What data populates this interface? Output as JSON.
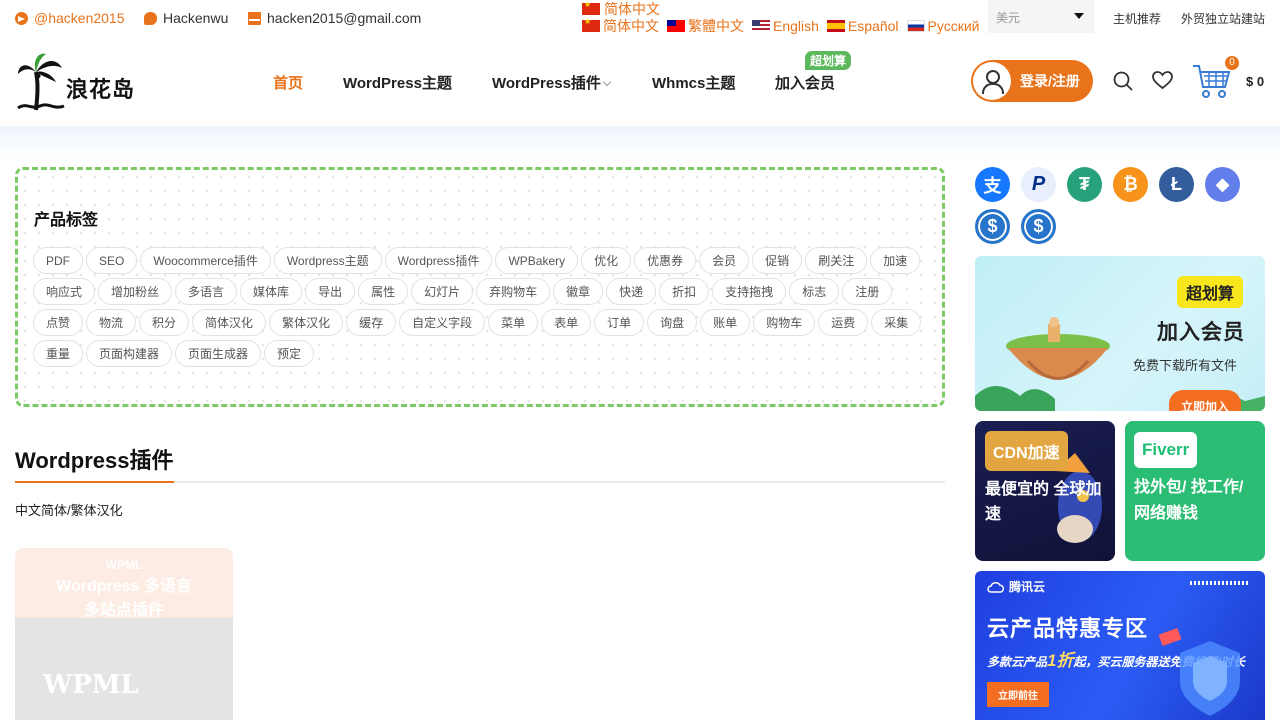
{
  "topbar": {
    "telegram": "@hacken2015",
    "wechat": "Hackenwu",
    "email": "hacken2015@gmail.com",
    "language_current": "简体中文",
    "languages": [
      "简体中文",
      "繁體中文",
      "English",
      "Español",
      "Русский"
    ],
    "currency": "美元",
    "links": [
      "主机推荐",
      "外贸独立站建站"
    ]
  },
  "header": {
    "logo_text": "浪花岛",
    "nav": [
      "首页",
      "WordPress主题",
      "WordPress插件",
      "Whmcs主题",
      "加入会员"
    ],
    "nav_badge": "超划算",
    "login_label": "登录/注册",
    "cart_count": "0",
    "cart_total": "$ 0"
  },
  "tags": {
    "title": "产品标签",
    "items": [
      "PDF",
      "SEO",
      "Woocommerce插件",
      "Wordpress主题",
      "Wordpress插件",
      "WPBakery",
      "优化",
      "优惠券",
      "会员",
      "促销",
      "刷关注",
      "加速",
      "响应式",
      "增加粉丝",
      "多语言",
      "媒体库",
      "导出",
      "属性",
      "幻灯片",
      "弃购物车",
      "徽章",
      "快递",
      "折扣",
      "支持拖拽",
      "标志",
      "注册",
      "点赞",
      "物流",
      "积分",
      "简体汉化",
      "繁体汉化",
      "缓存",
      "自定义字段",
      "菜单",
      "表单",
      "订单",
      "询盘",
      "账单",
      "购物车",
      "运费",
      "采集",
      "重量",
      "页面构建器",
      "页面生成器",
      "预定"
    ]
  },
  "section": {
    "title": "Wordpress插件",
    "subtitle": "中文简体/繁体汉化",
    "card_line1": "WPML",
    "card_line2": "Wordpress 多语言",
    "card_line3": "多站点插件",
    "card_brand": "WPML"
  },
  "sidebar": {
    "payment_icons": [
      "alipay-icon",
      "paypal-icon",
      "tether-icon",
      "bitcoin-icon",
      "litecoin-icon",
      "ethereum-icon",
      "usdc-icon",
      "usdc-icon"
    ],
    "member_badge": "超划算",
    "member_title": "加入会员",
    "member_sub": "免费下载所有文件",
    "member_button": "立即加入",
    "cdn_badge": "CDN加速",
    "cdn_text": "最便宜的 全球加速",
    "fiverr_badge": "Fiverr",
    "fiverr_text": "找外包/ 找工作/ 网络赚钱",
    "tc_logo": "腾讯云",
    "tc_title": "云产品特惠专区",
    "tc_sub_a": "多款云产品",
    "tc_sub_em": "1折",
    "tc_sub_b": "起，买云服务器送免费机器/时长",
    "tc_button": "立即前往"
  },
  "colors": {
    "accent": "#e8731a",
    "tag_border": "#7ccb67",
    "badge_green": "#5cb85c"
  }
}
